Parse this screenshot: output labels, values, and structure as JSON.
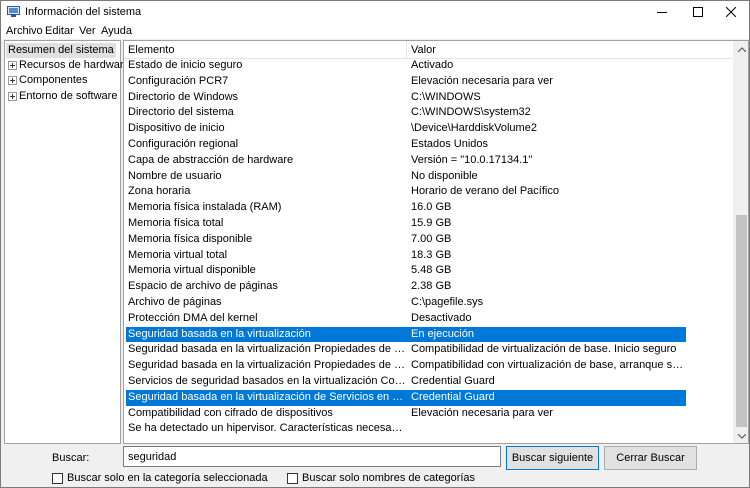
{
  "window": {
    "title": "Información del sistema"
  },
  "menu": [
    "Archivo",
    "Editar",
    "Ver",
    "Ayuda"
  ],
  "tree": {
    "items": [
      {
        "label": "Resumen del sistema",
        "selected": true,
        "expandable": false
      },
      {
        "label": "Recursos de hardware",
        "selected": false,
        "expandable": true
      },
      {
        "label": "Componentes",
        "selected": false,
        "expandable": true
      },
      {
        "label": "Entorno de software",
        "selected": false,
        "expandable": true
      }
    ]
  },
  "list": {
    "columns": [
      "Elemento",
      "Valor"
    ],
    "rows": [
      {
        "item": "Estado de inicio seguro",
        "value": "Activado",
        "selected": false
      },
      {
        "item": "Configuración PCR7",
        "value": "Elevación necesaria para ver",
        "selected": false
      },
      {
        "item": "Directorio de Windows",
        "value": "C:\\WINDOWS",
        "selected": false
      },
      {
        "item": "Directorio del sistema",
        "value": "C:\\WINDOWS\\system32",
        "selected": false
      },
      {
        "item": "Dispositivo de inicio",
        "value": "\\Device\\HarddiskVolume2",
        "selected": false
      },
      {
        "item": "Configuración regional",
        "value": "Estados Unidos",
        "selected": false
      },
      {
        "item": "Capa de abstracción de hardware",
        "value": "Versión = \"10.0.17134.1\"",
        "selected": false
      },
      {
        "item": "Nombre de usuario",
        "value": "No disponible",
        "selected": false
      },
      {
        "item": "Zona horaria",
        "value": "Horario de verano del Pacífico",
        "selected": false
      },
      {
        "item": "Memoria física instalada (RAM)",
        "value": "16.0 GB",
        "selected": false
      },
      {
        "item": "Memoria física total",
        "value": "15.9 GB",
        "selected": false
      },
      {
        "item": "Memoria física disponible",
        "value": "7.00 GB",
        "selected": false
      },
      {
        "item": "Memoria virtual total",
        "value": "18.3 GB",
        "selected": false
      },
      {
        "item": "Memoria virtual disponible",
        "value": "5.48 GB",
        "selected": false
      },
      {
        "item": "Espacio de archivo de páginas",
        "value": "2.38 GB",
        "selected": false
      },
      {
        "item": "Archivo de páginas",
        "value": "C:\\pagefile.sys",
        "selected": false
      },
      {
        "item": "Protección DMA del kernel",
        "value": "Desactivado",
        "selected": false
      },
      {
        "item": "Seguridad basada en la virtualización",
        "value": "En ejecución",
        "selected": true
      },
      {
        "item": "Seguridad basada en la virtualización Propiedades de seguri...",
        "value": "Compatibilidad de virtualización de base. Inicio seguro",
        "selected": false
      },
      {
        "item": "Seguridad basada en la virtualización Propiedades de seguri...",
        "value": "Compatibilidad con virtualización de base, arranque segur...",
        "selected": false
      },
      {
        "item": "Servicios de seguridad basados en la virtualización Configur...",
        "value": "Credential Guard",
        "selected": false
      },
      {
        "item": "Seguridad basada en la virtualización de Servicios en funcio...",
        "value": "Credential Guard",
        "selected": true
      },
      {
        "item": "Compatibilidad con cifrado de dispositivos",
        "value": "Elevación necesaria para ver",
        "selected": false
      },
      {
        "item": "Se ha detectado un hipervisor. Características necesarias par...",
        "value": "",
        "selected": false
      }
    ]
  },
  "search": {
    "label": "Buscar:",
    "value": "seguridad",
    "find_next_label": "Buscar siguiente",
    "clear_label": "Cerrar Buscar",
    "only_selected_category_label": "Buscar solo en la categoría seleccionada",
    "only_category_names_label": "Buscar solo nombres de categorías"
  },
  "colors": {
    "selection": "#0078d7"
  }
}
